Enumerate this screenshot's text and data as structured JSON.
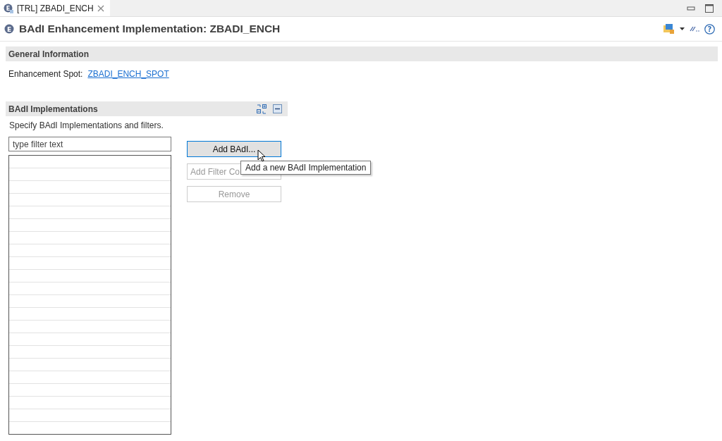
{
  "tab": {
    "icon_glyph": "E",
    "label": "[TRL] ZBADI_ENCH",
    "selected": true
  },
  "editor": {
    "icon_glyph": "E",
    "title": "BAdI Enhancement Implementation: ZBADI_ENCH",
    "help_glyph": "?"
  },
  "general_information": {
    "title": "General Information",
    "field_label": "Enhancement Spot:",
    "link": "ZBADI_ENCH_SPOT"
  },
  "implementations": {
    "title": "BAdI Implementations",
    "description": "Specify BAdI Implementations and filters.",
    "filter": {
      "placeholder": "type filter text"
    },
    "buttons": [
      {
        "label": "Add BAdI...",
        "disabled": false,
        "focused": true
      },
      {
        "label": "Add Filter Co",
        "disabled": true,
        "focused": false,
        "cut": true
      },
      {
        "label": "Remove",
        "disabled": true,
        "focused": false
      }
    ],
    "tooltip": "Add a new BAdI Implementation"
  }
}
